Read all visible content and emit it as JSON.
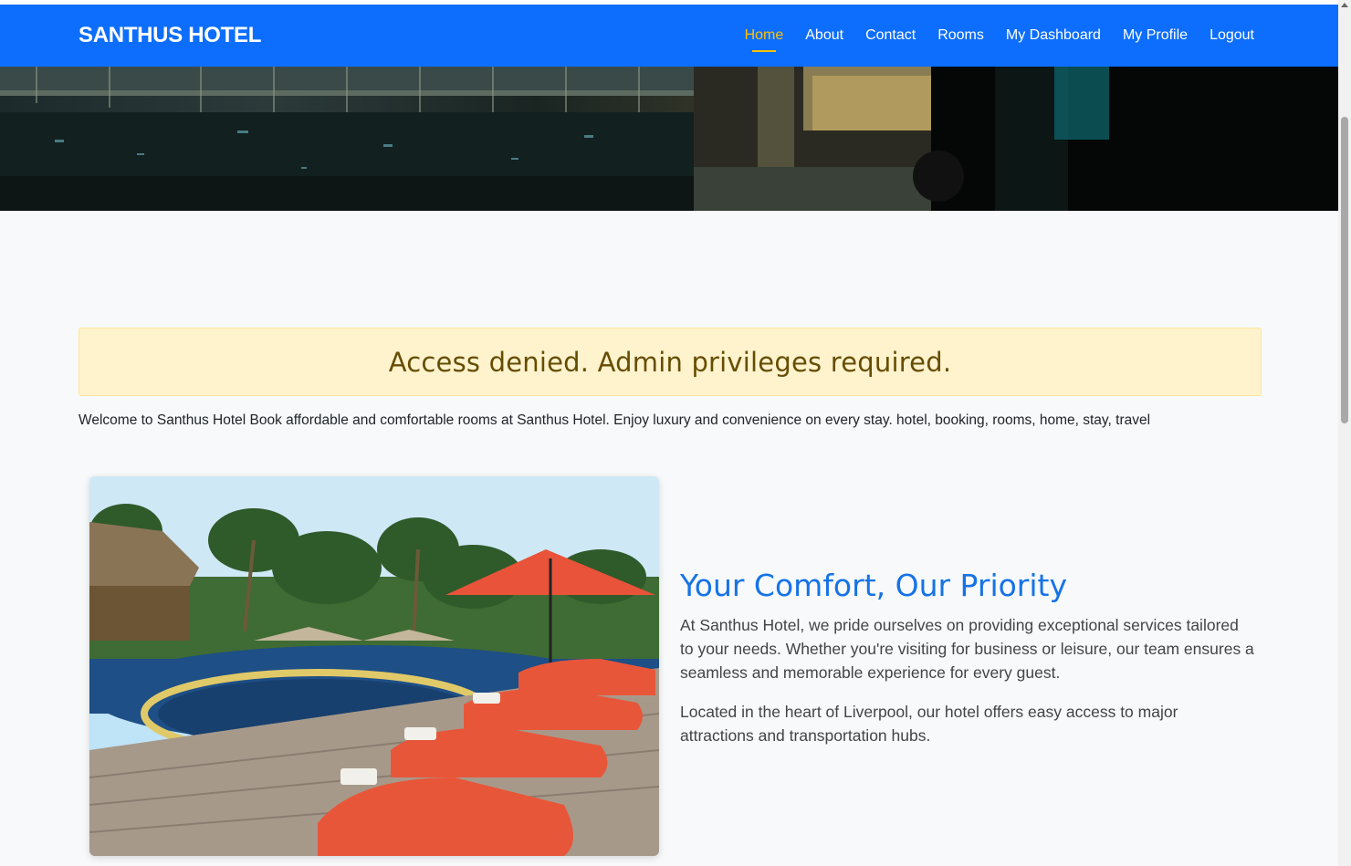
{
  "brand": "SANTHUS HOTEL",
  "nav": {
    "items": [
      {
        "label": "Home",
        "active": true
      },
      {
        "label": "About"
      },
      {
        "label": "Contact"
      },
      {
        "label": "Rooms"
      },
      {
        "label": "My Dashboard"
      },
      {
        "label": "My Profile"
      },
      {
        "label": "Logout"
      }
    ]
  },
  "alert": {
    "message": "Access denied. Admin privileges required."
  },
  "welcome_text": "Welcome to Santhus Hotel Book affordable and comfortable rooms at Santhus Hotel. Enjoy luxury and convenience on every stay. hotel, booking, rooms, home, stay, travel",
  "feature": {
    "title": "Your Comfort, Our Priority",
    "paragraphs": [
      "At Santhus Hotel, we pride ourselves on providing exceptional services tailored to your needs. Whether you're visiting for business or leisure, our team ensures a seamless and memorable experience for every guest.",
      "Located in the heart of Liverpool, our hotel offers easy access to major attractions and transportation hubs."
    ]
  },
  "colors": {
    "navbar": "#0d6efd",
    "active_link": "#ffc107",
    "alert_bg": "#fff3cd",
    "alert_text": "#664d03",
    "feature_title": "#1673e6"
  }
}
